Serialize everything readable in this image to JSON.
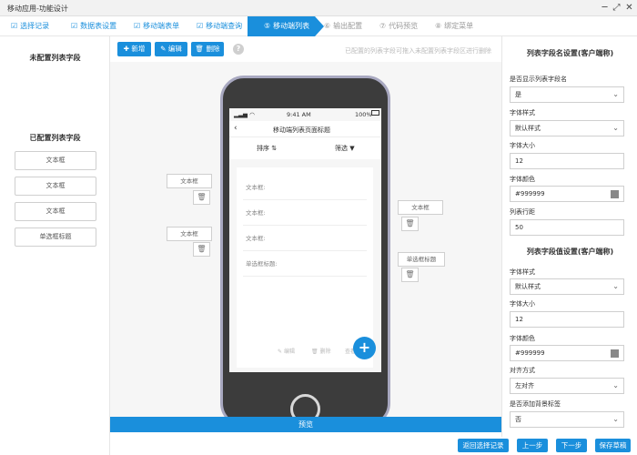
{
  "window": {
    "title": "移动应用-功能设计"
  },
  "steps": [
    {
      "label": "选择记录",
      "state": "done"
    },
    {
      "label": "数据表设置",
      "state": "done"
    },
    {
      "label": "移动端表单",
      "state": "done"
    },
    {
      "label": "移动端查询",
      "state": "done"
    },
    {
      "label": "移动端列表",
      "state": "active",
      "number": "⑤"
    },
    {
      "label": "输出配置",
      "state": "todo",
      "number": "⑥"
    },
    {
      "label": "代码预览",
      "state": "todo",
      "number": "⑦"
    },
    {
      "label": "绑定菜单",
      "state": "todo",
      "number": "⑧"
    }
  ],
  "left": {
    "unconfigured_title": "未配置列表字段",
    "configured_title": "已配置列表字段",
    "configured_items": [
      "文本框",
      "文本框",
      "文本框",
      "单选框标题"
    ]
  },
  "toolbar": {
    "add": "新增",
    "edit": "编辑",
    "delete": "删除",
    "help": "?",
    "hint": "已配置的列表字段可拖入未配置列表字段区进行删除"
  },
  "phone": {
    "time": "9:41 AM",
    "battery": "100%",
    "page_title": "移动端列表页面标题",
    "sort_label": "排序",
    "filter_label": "筛选",
    "rows": [
      "文本框:",
      "文本框:",
      "文本框:",
      "单选框标题:"
    ],
    "actions": {
      "edit": "编辑",
      "delete": "删除",
      "view": "查看"
    }
  },
  "field_tags": {
    "left_top": "文本框",
    "left_bottom": "文本框",
    "right_top": "文本框",
    "right_bottom": "单选框标题"
  },
  "preview_label": "预览",
  "right": {
    "name_section_title": "列表字段名设置(客户端称)",
    "show_name_label": "是否显示列表字段名",
    "show_name_value": "是",
    "font_style_label": "字体样式",
    "font_style_value": "默认样式",
    "font_size_label": "字体大小",
    "font_size_value": "12",
    "font_color_label": "字体颜色",
    "font_color_value": "#999999",
    "row_height_label": "列表行距",
    "row_height_value": "50",
    "value_section_title": "列表字段值设置(客户端称)",
    "v_font_style_label": "字体样式",
    "v_font_style_value": "默认样式",
    "v_font_size_label": "字体大小",
    "v_font_size_value": "12",
    "v_font_color_label": "字体颜色",
    "v_font_color_value": "#999999",
    "align_label": "对齐方式",
    "align_value": "左对齐",
    "bg_label_label": "是否添加背景标签",
    "bg_label_value": "否"
  },
  "bottom": {
    "return": "返回选择记录",
    "prev": "上一步",
    "next": "下一步",
    "save": "保存草稿"
  },
  "colors": {
    "accent": "#1a8fdc"
  }
}
